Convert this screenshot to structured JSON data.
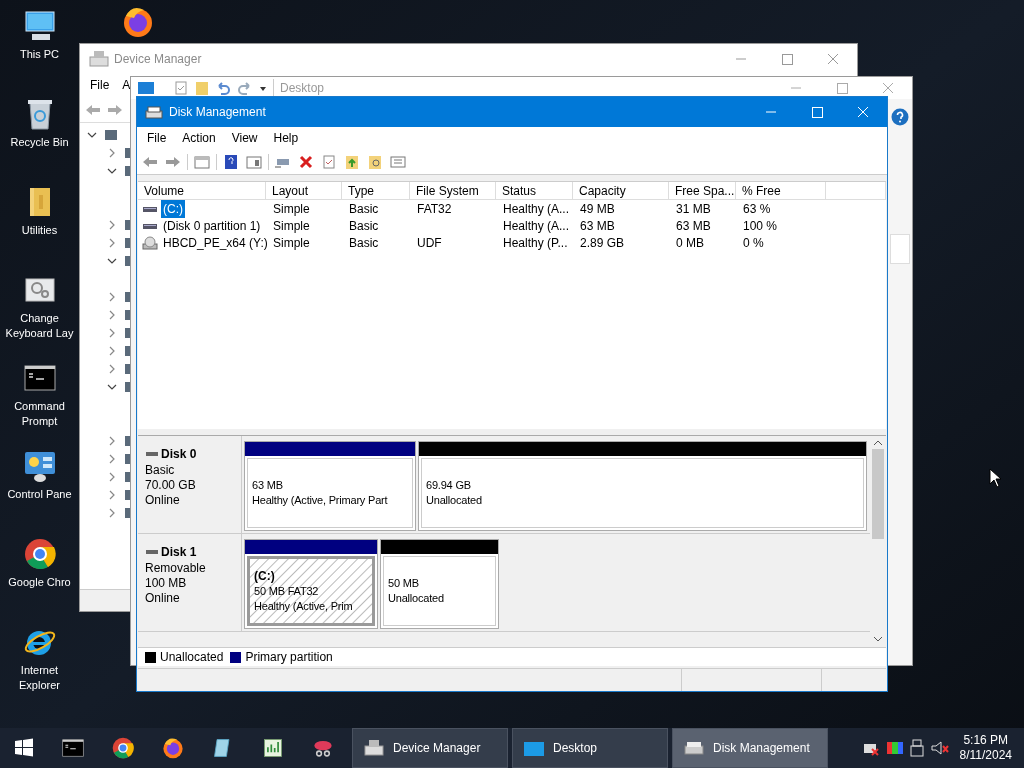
{
  "desktop_icons": [
    {
      "label": "This PC",
      "kind": "pc"
    },
    {
      "label": "Recycle Bin",
      "kind": "bin"
    },
    {
      "label": "Utilities",
      "kind": "folder"
    },
    {
      "label": "Change Keyboard Lay",
      "kind": "keyboard"
    },
    {
      "label": "Command Prompt",
      "kind": "cmd"
    },
    {
      "label": "Control Pane",
      "kind": "control"
    },
    {
      "label": "Google Chro",
      "kind": "chrome"
    },
    {
      "label": "Internet Explorer",
      "kind": "ie"
    }
  ],
  "device_manager": {
    "title": "Device Manager",
    "menu": [
      "File",
      "A"
    ],
    "tree": [
      {
        "kind": "category",
        "expanded": true,
        "children": [
          {
            "kind": "category",
            "expanded": false
          },
          {
            "kind": "category",
            "expanded": true
          },
          {
            "kind": "category",
            "expanded": false
          },
          {
            "kind": "category",
            "expanded": false
          },
          {
            "kind": "category",
            "expanded": true
          },
          {
            "kind": "category",
            "expanded": false
          },
          {
            "kind": "category",
            "expanded": false
          },
          {
            "kind": "category",
            "expanded": false
          },
          {
            "kind": "category",
            "expanded": false
          },
          {
            "kind": "category",
            "expanded": false
          },
          {
            "kind": "category",
            "expanded": true
          },
          {
            "kind": "category",
            "expanded": false
          },
          {
            "kind": "category",
            "expanded": false
          },
          {
            "kind": "category",
            "expanded": false
          },
          {
            "kind": "category",
            "expanded": false
          },
          {
            "kind": "category",
            "expanded": false
          }
        ]
      }
    ]
  },
  "explorer": {
    "location": "Desktop"
  },
  "disk_management": {
    "title": "Disk Management",
    "menu": [
      "File",
      "Action",
      "View",
      "Help"
    ],
    "columns": [
      "Volume",
      "Layout",
      "Type",
      "File System",
      "Status",
      "Capacity",
      "Free Spa...",
      "% Free"
    ],
    "rows": [
      {
        "kind": "drive",
        "volume": "(C:)",
        "layout": "Simple",
        "type": "Basic",
        "file_system": "FAT32",
        "status": "Healthy (A...",
        "capacity": "49 MB",
        "free_space": "31 MB",
        "percent_free": "63 %",
        "selected": true
      },
      {
        "kind": "drive",
        "volume": "(Disk 0 partition 1)",
        "layout": "Simple",
        "type": "Basic",
        "status": "Healthy (A...",
        "capacity": "63 MB",
        "free_space": "63 MB",
        "percent_free": "100 %",
        "selected": false
      },
      {
        "kind": "disc",
        "volume": "HBCD_PE_x64 (Y:)",
        "layout": "Simple",
        "type": "Basic",
        "file_system": "UDF",
        "status": "Healthy (P...",
        "capacity": "2.89 GB",
        "free_space": "0 MB",
        "percent_free": "0 %",
        "selected": false
      }
    ],
    "disks": [
      {
        "name": "Disk 0",
        "type": "Basic",
        "size": "70.00 GB",
        "state": "Online",
        "partitions": [
          {
            "kind": "primary",
            "lines": [
              "63 MB",
              "Healthy (Active, Primary Part"
            ],
            "selected": false
          },
          {
            "kind": "unallocated",
            "lines": [
              "69.94 GB",
              "Unallocated"
            ],
            "selected": false
          }
        ]
      },
      {
        "name": "Disk 1",
        "type": "Removable",
        "size": "100 MB",
        "state": "Online",
        "partitions": [
          {
            "kind": "primary",
            "title": "(C:)",
            "lines": [
              "50 MB FAT32",
              "Healthy (Active, Prim"
            ],
            "selected": true
          },
          {
            "kind": "unallocated",
            "lines": [
              "50 MB",
              "Unallocated"
            ],
            "selected": false
          }
        ]
      }
    ],
    "legend": [
      {
        "label": "Unallocated",
        "color": "#000000"
      },
      {
        "label": "Primary partition",
        "color": "#000080"
      }
    ]
  },
  "taskbar": {
    "pinned": [
      {
        "kind": "cmd"
      },
      {
        "kind": "chrome"
      },
      {
        "kind": "firefox"
      },
      {
        "kind": "book"
      },
      {
        "kind": "notepad"
      },
      {
        "kind": "snip"
      }
    ],
    "windows": [
      {
        "label": "Device Manager",
        "kind": "devmgr",
        "selected": false
      },
      {
        "label": "Desktop",
        "kind": "folder",
        "selected": false
      },
      {
        "label": "Disk Management",
        "kind": "disk",
        "selected": true
      }
    ],
    "time": "5:16 PM",
    "date": "8/11/2024"
  }
}
